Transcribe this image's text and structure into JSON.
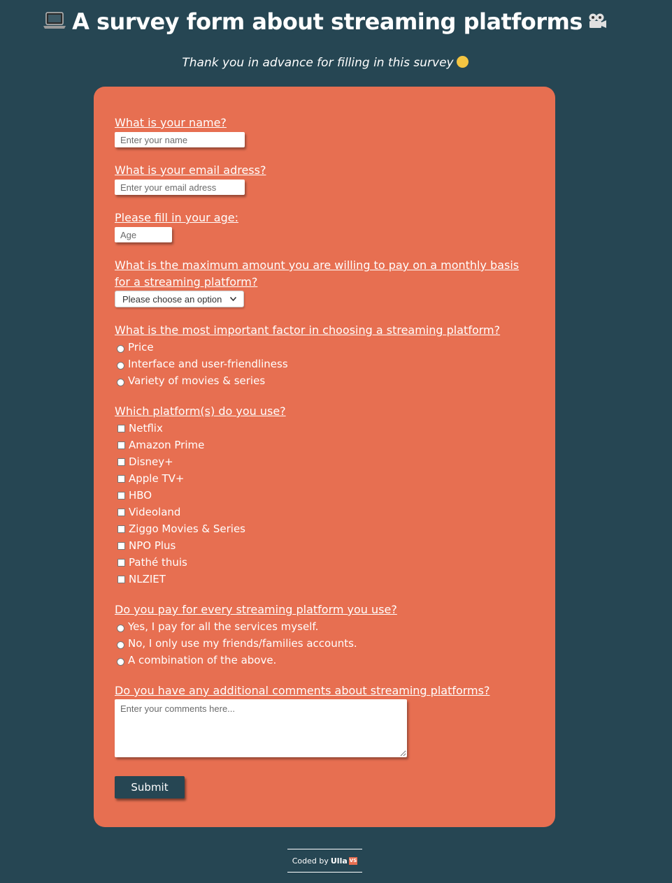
{
  "header": {
    "title": "A survey form about streaming platforms",
    "title_icon_left": "laptop-icon",
    "title_icon_right": "movie-camera-icon",
    "subtitle": "Thank you in advance for filling in this survey",
    "subtitle_icon": "hugging-face-icon"
  },
  "form": {
    "name": {
      "label": "What is your name?",
      "placeholder": "Enter your name",
      "value": ""
    },
    "email": {
      "label": "What is your email adress?",
      "placeholder": "Enter your email adress",
      "value": ""
    },
    "age": {
      "label": "Please fill in your age:",
      "placeholder": "Age",
      "value": ""
    },
    "max_amount": {
      "label_line1": "What is the maximum amount you are willing to pay on a monthly basis",
      "label_line2": "for a streaming platform?",
      "selected": "Please choose an option"
    },
    "factor": {
      "label": "What is the most important factor in choosing a streaming platform?",
      "options": [
        "Price",
        "Interface and user-friendliness",
        "Variety of movies & series"
      ]
    },
    "platforms": {
      "label": "Which platform(s) do you use?",
      "options": [
        "Netflix",
        "Amazon Prime",
        "Disney+",
        "Apple TV+",
        "HBO",
        "Videoland",
        "Ziggo Movies & Series",
        "NPO Plus",
        "Pathé thuis",
        "NLZIET"
      ]
    },
    "payment": {
      "label": "Do you pay for every streaming platform you use?",
      "options": [
        "Yes, I pay for all the services myself.",
        "No, I only use my friends/families accounts.",
        "A combination of the above."
      ]
    },
    "comments": {
      "label": "Do you have any additional comments about streaming platforms?",
      "placeholder": "Enter your comments here...",
      "value": ""
    },
    "submit_label": "Submit"
  },
  "footer": {
    "coded_by": "Coded by",
    "author": "Ulla",
    "logo_text": "VS"
  },
  "colors": {
    "background": "#264653",
    "card": "#e76f51",
    "text": "#ffffff"
  }
}
